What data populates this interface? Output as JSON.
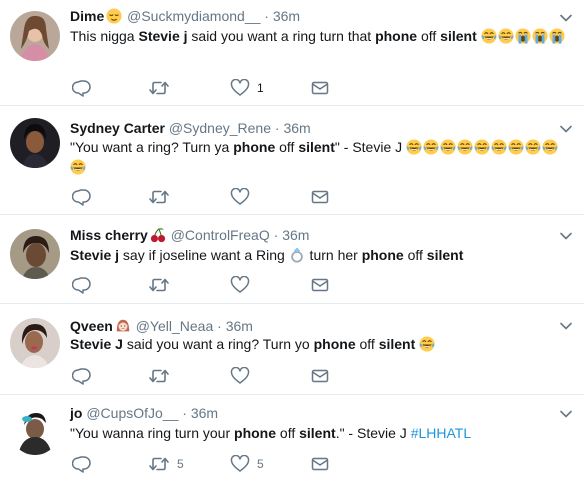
{
  "tweets": [
    {
      "name": "Dime",
      "handle": "@Suckmydiamond__",
      "dot": "·",
      "time": "36m",
      "parts": [
        {
          "t": "This nigga "
        },
        {
          "t": "Stevie j",
          "b": true
        },
        {
          "t": " said you want a ring turn that "
        },
        {
          "t": "phone",
          "b": true
        },
        {
          "t": " off "
        },
        {
          "t": "silent",
          "b": true
        },
        {
          "t": " "
        }
      ],
      "reply_count": "",
      "retweet_count": "",
      "like_count": "1"
    },
    {
      "name": "Sydney Carter",
      "handle": "@Sydney_Rene",
      "dot": "·",
      "time": "36m",
      "parts": [
        {
          "t": "\"You want a ring? Turn ya "
        },
        {
          "t": "phone",
          "b": true
        },
        {
          "t": " off "
        },
        {
          "t": "silent",
          "b": true
        },
        {
          "t": "\" - Stevie J "
        }
      ],
      "reply_count": "",
      "retweet_count": "",
      "like_count": ""
    },
    {
      "name": "Miss cherry",
      "handle": "@ControlFreaQ",
      "dot": "·",
      "time": "36m",
      "parts": [
        {
          "t": "Stevie j",
          "b": true
        },
        {
          "t": " say if joseline want a Ring "
        },
        {
          "t": " turn her "
        },
        {
          "t": "phone",
          "b": true
        },
        {
          "t": " off "
        },
        {
          "t": "silent",
          "b": true
        }
      ],
      "reply_count": "",
      "retweet_count": "",
      "like_count": ""
    },
    {
      "name": "Qveen",
      "handle": "@Yell_Neaa",
      "dot": "·",
      "time": "36m",
      "parts": [
        {
          "t": "Stevie J",
          "b": true
        },
        {
          "t": " said you want a ring? Turn yo "
        },
        {
          "t": "phone",
          "b": true
        },
        {
          "t": " off "
        },
        {
          "t": "silent",
          "b": true
        },
        {
          "t": " "
        }
      ],
      "reply_count": "",
      "retweet_count": "",
      "like_count": ""
    },
    {
      "name": "jo",
      "handle": "@CupsOfJo__",
      "dot": "·",
      "time": "36m",
      "parts": [
        {
          "t": "\"You wanna ring turn your "
        },
        {
          "t": "phone",
          "b": true
        },
        {
          "t": " off "
        },
        {
          "t": "silent",
          "b": true
        },
        {
          "t": ".\" - Stevie J "
        },
        {
          "t": "#LHHATL",
          "h": true
        }
      ],
      "reply_count": "",
      "retweet_count": "5",
      "like_count": "5"
    }
  ],
  "icons": {
    "reply": "reply-icon",
    "retweet": "retweet-icon",
    "like": "heart-icon",
    "dm": "envelope-icon",
    "caret": "chevron-down-icon",
    "laugh": "face-with-tears-of-joy-emoji",
    "cry": "loudly-crying-face-emoji",
    "relieved": "relieved-face-emoji",
    "cherries": "cherries-emoji",
    "ring": "ring-emoji",
    "woman": "woman-emoji"
  },
  "colors": {
    "text": "#14171a",
    "muted": "#657786",
    "link": "#1b95e0",
    "divider": "#e6ecf0",
    "emoji": "#ffcc4d"
  }
}
